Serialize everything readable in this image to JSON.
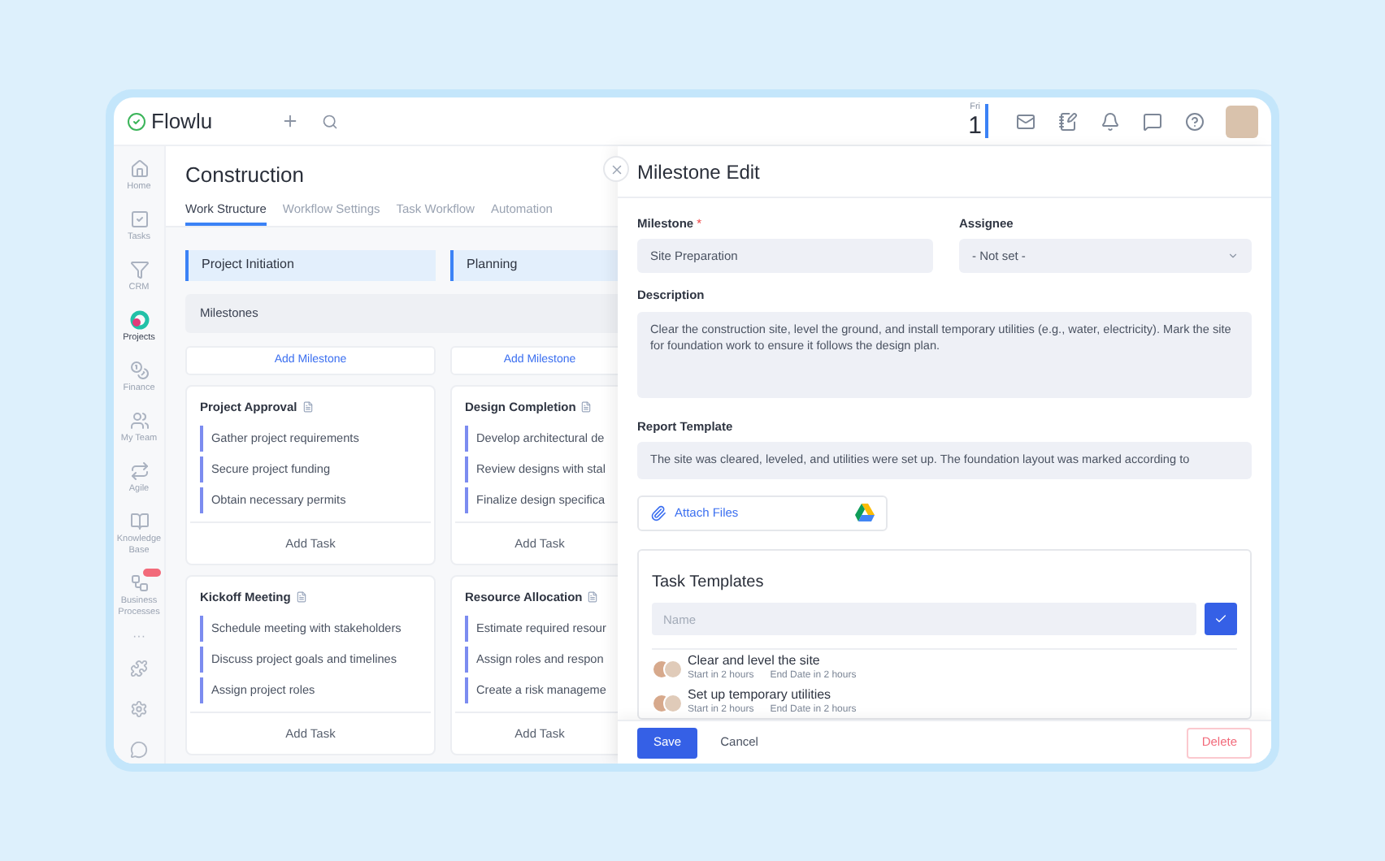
{
  "app": {
    "logo": "Flowlu"
  },
  "topbar": {
    "day": "Fri",
    "date": "1"
  },
  "sidebar": {
    "items": [
      {
        "label": "Home",
        "selected": false
      },
      {
        "label": "Tasks",
        "selected": false
      },
      {
        "label": "CRM",
        "selected": false
      },
      {
        "label": "Projects",
        "selected": true
      },
      {
        "label": "Finance",
        "selected": false
      },
      {
        "label": "My Team",
        "selected": false
      },
      {
        "label": "Agile",
        "selected": false
      },
      {
        "label": "Knowledge Base",
        "selected": false
      },
      {
        "label": "Business Processes",
        "selected": false,
        "badge": true
      }
    ],
    "more": "···"
  },
  "project": {
    "title": "Construction",
    "tabs": [
      {
        "label": "Work Structure",
        "selected": true
      },
      {
        "label": "Workflow Settings",
        "selected": false
      },
      {
        "label": "Task Workflow",
        "selected": false
      },
      {
        "label": "Automation",
        "selected": false
      }
    ],
    "milestones_header": "Milestones",
    "stages": [
      {
        "title": "Project Initiation",
        "add_label": "Add Milestone",
        "milestones": [
          {
            "title": "Project Approval",
            "tasks": [
              "Gather project requirements",
              "Secure project funding",
              "Obtain necessary permits"
            ],
            "add_label": "Add Task"
          },
          {
            "title": "Kickoff Meeting",
            "tasks": [
              "Schedule meeting with stakeholders",
              "Discuss project goals and timelines",
              "Assign project roles"
            ],
            "add_label": "Add Task"
          }
        ]
      },
      {
        "title": "Planning",
        "add_label": "Add Milestone",
        "milestones": [
          {
            "title": "Design Completion",
            "tasks": [
              "Develop architectural de",
              "Review designs with stal",
              "Finalize design specifica"
            ],
            "add_label": "Add Task"
          },
          {
            "title": "Resource Allocation",
            "tasks": [
              "Estimate required resour",
              "Assign roles and respon",
              "Create a risk manageme"
            ],
            "add_label": "Add Task"
          }
        ]
      }
    ]
  },
  "drawer": {
    "title": "Milestone Edit",
    "milestone": {
      "label": "Milestone",
      "required": true,
      "required_mark": "*",
      "value": "Site Preparation"
    },
    "assignee": {
      "label": "Assignee",
      "value": "- Not set -"
    },
    "description": {
      "label": "Description",
      "value": "Clear the construction site, level the ground, and install temporary utilities (e.g., water, electricity). Mark the site for foundation work to ensure it follows the design plan."
    },
    "report_template": {
      "label": "Report Template",
      "value": "The site was cleared, leveled, and utilities were set up. The foundation layout was marked according to"
    },
    "attach_label": "Attach Files",
    "task_templates": {
      "title": "Task Templates",
      "placeholder": "Name",
      "items": [
        {
          "title": "Clear and level the site",
          "start": "Start in 2 hours",
          "end": "End Date in 2 hours"
        },
        {
          "title": "Set up temporary utilities",
          "start": "Start in 2 hours",
          "end": "End Date in 2 hours"
        }
      ]
    },
    "footer": {
      "save": "Save",
      "cancel": "Cancel",
      "delete": "Delete"
    }
  }
}
